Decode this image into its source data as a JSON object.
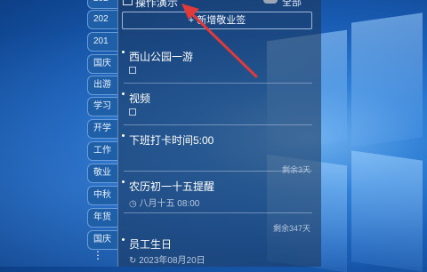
{
  "tabs": [
    "202",
    "202",
    "201",
    "国庆",
    "出游",
    "学习",
    "开学",
    "工作",
    "敬业",
    "中秋",
    "年货",
    "国庆"
  ],
  "header": {
    "title": "操作演示",
    "filter": "全部"
  },
  "add_button": "新增敬业签",
  "notes": [
    {
      "title": "西山公园一游",
      "sub": "",
      "remain": ""
    },
    {
      "title": "视频",
      "sub": "",
      "remain": ""
    },
    {
      "title": "下班打卡时间5:00",
      "sub": "",
      "remain": "剩余3天"
    },
    {
      "title": "农历初一十五提醒",
      "sub": "八月十五 08:00",
      "remain": "剩余347天"
    },
    {
      "title": "员工生日",
      "sub": "2023年08月20日",
      "remain": ""
    }
  ],
  "colors": {
    "arrow": "#e03a3a",
    "accent": "#1f5fa8"
  }
}
